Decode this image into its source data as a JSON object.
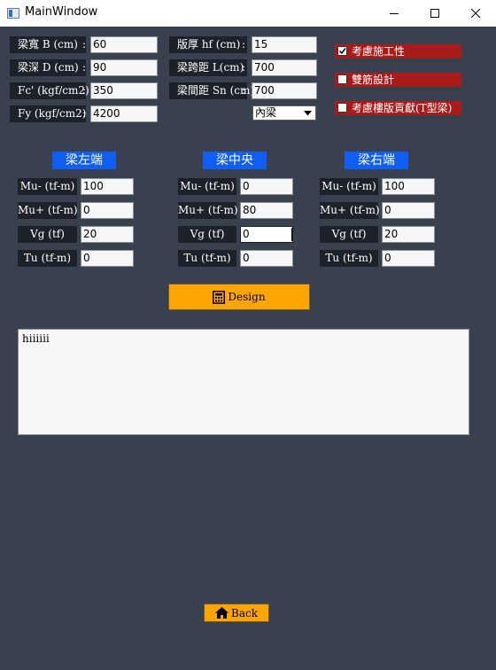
{
  "window": {
    "title": "MainWindow"
  },
  "section_params": {
    "rows": [
      {
        "label": "梁寬 B (cm)",
        "value": "60"
      },
      {
        "label": "梁深 D (cm)",
        "value": "90"
      },
      {
        "label": "Fc' (kgf/cm2)",
        "value": "350"
      },
      {
        "label": "Fy (kgf/cm2)",
        "value": "4200"
      }
    ]
  },
  "slab_params": {
    "rows": [
      {
        "label": "版厚 hf (cm)",
        "value": "15"
      },
      {
        "label": "梁跨距 L(cm)",
        "value": "700"
      },
      {
        "label": "梁間距 Sn (cm)",
        "value": "700"
      }
    ],
    "beam_type": "內梁"
  },
  "options": [
    {
      "label": "考慮施工性",
      "checked": true
    },
    {
      "label": "雙筋設計",
      "checked": false
    },
    {
      "label": "考慮樓版貢獻(T型梁)",
      "checked": false
    }
  ],
  "sections": [
    {
      "title": "梁左端",
      "rows": [
        {
          "label": "Mu- (tf-m)",
          "value": "100"
        },
        {
          "label": "Mu+ (tf-m)",
          "value": "0"
        },
        {
          "label": "Vg (tf)",
          "value": "20"
        },
        {
          "label": "Tu (tf-m)",
          "value": "0"
        }
      ]
    },
    {
      "title": "梁中央",
      "rows": [
        {
          "label": "Mu- (tf-m)",
          "value": "0"
        },
        {
          "label": "Mu+ (tf-m)",
          "value": "80"
        },
        {
          "label": "Vg (tf)",
          "value": "0"
        },
        {
          "label": "Tu (tf-m)",
          "value": "0"
        }
      ]
    },
    {
      "title": "梁右端",
      "rows": [
        {
          "label": "Mu- (tf-m)",
          "value": "100"
        },
        {
          "label": "Mu+ (tf-m)",
          "value": "0"
        },
        {
          "label": "Vg (tf)",
          "value": "20"
        },
        {
          "label": "Tu (tf-m)",
          "value": "0"
        }
      ]
    }
  ],
  "design_button": {
    "label": "Design",
    "icon": "calculator-icon"
  },
  "output": {
    "text": "hiiiiii"
  },
  "back_button": {
    "label": "Back",
    "icon": "home-icon"
  },
  "colors": {
    "background": "#39414f",
    "label_bg": "#1d2129",
    "section_title": "#0f5ef5",
    "button": "#ffa500",
    "checkbox_bg": "#a81b1b"
  }
}
